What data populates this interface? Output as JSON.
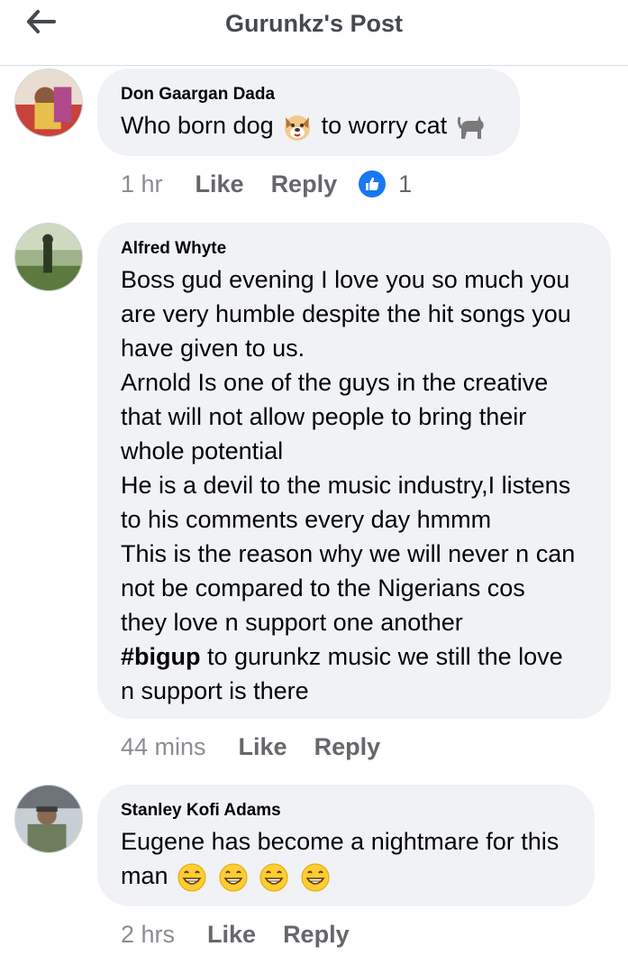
{
  "header": {
    "title": "Gurunkz's Post",
    "back_icon": "back-arrow-icon"
  },
  "comments": [
    {
      "author": "Don Gaargan Dada",
      "text_before_dog": "Who born dog",
      "text_before_cat": "to worry cat",
      "emojis": [
        "dog-face-emoji",
        "cat-emoji"
      ],
      "time": "1 hr",
      "like_label": "Like",
      "reply_label": "Reply",
      "reaction_count": "1",
      "reaction_icon": "thumbs-up-icon"
    },
    {
      "author": "Alfred Whyte",
      "lines": [
        "Boss gud evening I love you so much you",
        "are very humble despite the hit songs you",
        "have given to us.",
        "Arnold Is one of the guys in the creative",
        "that will not allow people to bring their",
        "whole potential",
        "He is a devil to the music industry,I listens",
        "to his comments every day hmmm",
        "This is the reason why we will never n can",
        "not be compared to the Nigerians cos",
        "they love n support one  another"
      ],
      "hashtag": "#bigup",
      "line_after_hashtag": " to gurunkz music we still the love",
      "last_line": "n support is there",
      "time": "44 mins",
      "like_label": "Like",
      "reply_label": "Reply"
    },
    {
      "author": "Stanley Kofi Adams",
      "line1": "Eugene has become a nightmare for this",
      "line2": "man",
      "emojis": [
        "grinning-face-emoji",
        "grinning-face-emoji",
        "grinning-face-emoji",
        "grinning-face-emoji"
      ],
      "time": "2 hrs",
      "like_label": "Like",
      "reply_label": "Reply"
    }
  ],
  "colors": {
    "bubble": "#f0f2f5",
    "like_blue": "#1877f2",
    "secondary_text": "#65676b"
  }
}
